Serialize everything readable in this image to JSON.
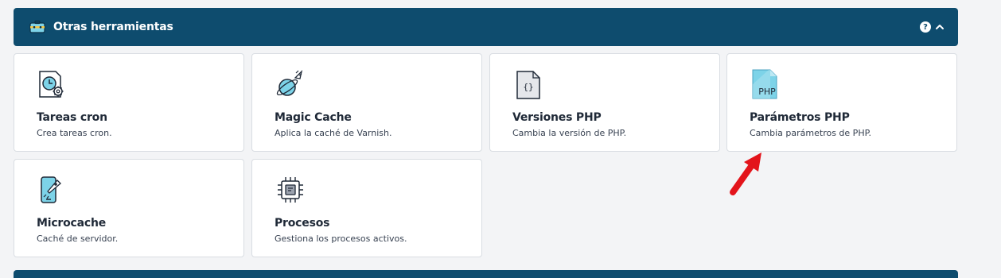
{
  "section": {
    "title": "Otras herramientas",
    "help_icon": "question-circle-icon",
    "collapse_icon": "chevron-up-icon",
    "header_color": "#0e4c6e"
  },
  "tools": [
    {
      "title": "Tareas cron",
      "description": "Crea tareas cron.",
      "icon": "clock-gear-icon"
    },
    {
      "title": "Magic Cache",
      "description": "Aplica la caché de Varnish.",
      "icon": "rocket-planet-icon"
    },
    {
      "title": "Versiones PHP",
      "description": "Cambia la versión de PHP.",
      "icon": "code-file-icon"
    },
    {
      "title": "Parámetros PHP",
      "description": "Cambia parámetros de PHP.",
      "icon": "php-file-icon"
    },
    {
      "title": "Microcache",
      "description": "Caché de servidor.",
      "icon": "phone-rocket-icon"
    },
    {
      "title": "Procesos",
      "description": "Gestiona los procesos activos.",
      "icon": "cpu-chip-icon"
    }
  ],
  "annotation": {
    "icon": "red-arrow-icon",
    "color": "#e3141b"
  }
}
